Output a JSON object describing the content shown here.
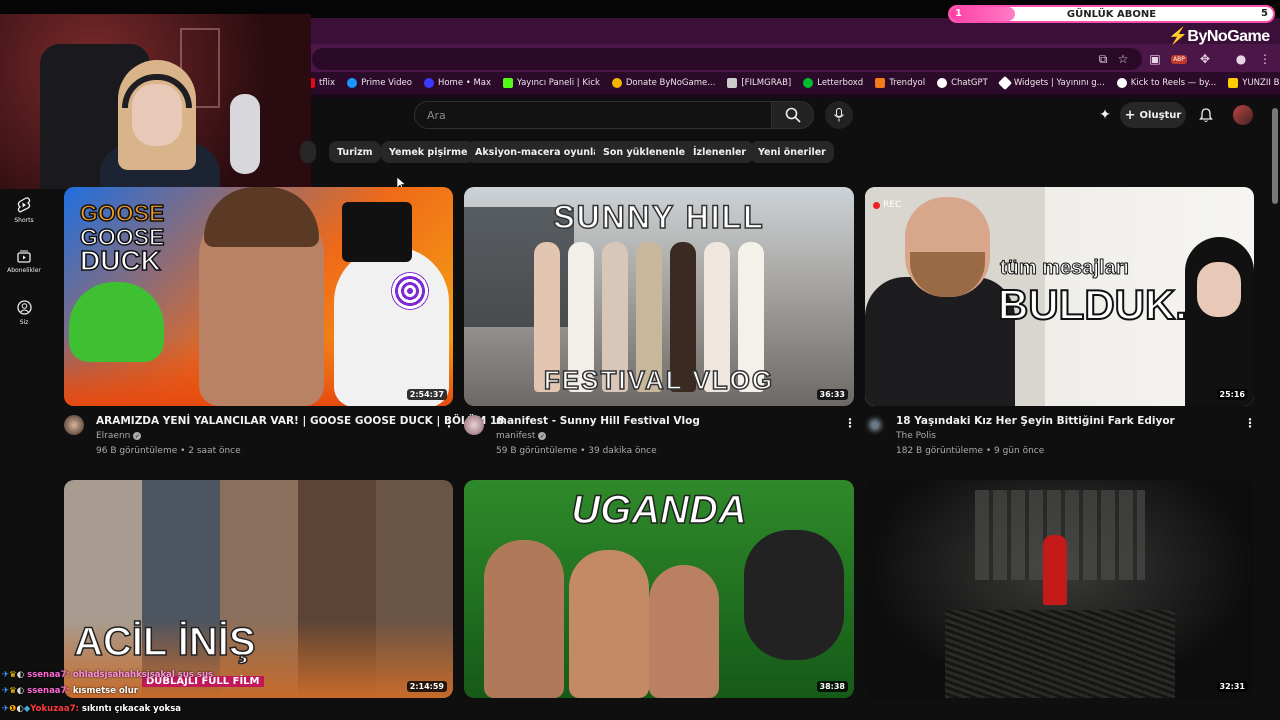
{
  "overlay": {
    "abone_label": "GÜNLÜK ABONE",
    "abone_min": "1",
    "abone_max": "5",
    "abone_progress": 0.2,
    "brand": "ByNoGame"
  },
  "bookmarks": [
    {
      "label": "tflix",
      "color": "#e50914"
    },
    {
      "label": "Prime Video",
      "color": "#1a98ff"
    },
    {
      "label": "Home • Max",
      "color": "#3b3bff"
    },
    {
      "label": "Yayıncı Paneli | Kick",
      "color": "#53fc18"
    },
    {
      "label": "Donate ByNoGame...",
      "color": "#f5b400"
    },
    {
      "label": "[FILMGRAB]",
      "color": "#cccccc"
    },
    {
      "label": "Letterboxd",
      "color": "#00c030"
    },
    {
      "label": "Trendyol",
      "color": "#f27a1a"
    },
    {
      "label": "ChatGPT",
      "color": "#ffffff"
    },
    {
      "label": "Widgets | Yayınını g...",
      "color": "#ffffff"
    },
    {
      "label": "Kick to Reels — by...",
      "color": "#ffffff"
    },
    {
      "label": "YUNZII B75 Pro Me...",
      "color": "#ffcc00"
    }
  ],
  "header": {
    "search_placeholder": "Ara",
    "create_label": "Oluştur"
  },
  "chips": [
    "Turizm",
    "Yemek pişirme",
    "Aksiyon-macera oyunları",
    "Son yüklenenler",
    "İzlenenler",
    "Yeni öneriler"
  ],
  "sidebar": [
    {
      "label": "Shorts",
      "icon": "shorts-icon"
    },
    {
      "label": "Abonelikler",
      "icon": "subscriptions-icon"
    },
    {
      "label": "Siz",
      "icon": "you-icon"
    }
  ],
  "videos": [
    {
      "title": "ARAMIZDA YENİ YALANCILAR VAR! | GOOSE GOOSE DUCK | BÖLÜM 18",
      "channel": "Elraenn",
      "verified": true,
      "meta": "96 B görüntüleme • 2 saat önce",
      "duration": "2:54:37",
      "thumb_text_1": "GOOSE",
      "thumb_text_2": "GOOSE",
      "thumb_text_3": "DUCK"
    },
    {
      "title": "manifest - Sunny Hill Festival Vlog",
      "channel": "manifest",
      "verified": true,
      "meta": "59 B görüntüleme • 39 dakika önce",
      "duration": "36:33",
      "thumb_text_1": "SUNNY HILL",
      "thumb_text_2": "FESTIVAL VLOG"
    },
    {
      "title": "18 Yaşındaki Kız Her Şeyin Bittiğini Fark Ediyor",
      "channel": "The Polis",
      "verified": false,
      "meta": "182 B görüntüleme • 9 gün önce",
      "duration": "25:16",
      "thumb_text_1": "tüm mesajları",
      "thumb_text_2": "BULDUK.",
      "thumb_text_3": "REC"
    },
    {
      "title": "",
      "channel": "",
      "verified": false,
      "meta": "",
      "duration": "2:14:59",
      "thumb_text_1": "ACİL İNİŞ",
      "thumb_text_2": "DUBLAJLI FULL FİLM"
    },
    {
      "title": "",
      "channel": "",
      "verified": false,
      "meta": "",
      "duration": "38:38",
      "thumb_text_1": "UGANDA"
    },
    {
      "title": "",
      "channel": "",
      "verified": false,
      "meta": "",
      "duration": "32:31"
    }
  ],
  "chat": [
    {
      "user": "ssenaa7:",
      "user_color": "#ff6ad5",
      "message": "ohladsjsahahksjsakal sus sus",
      "msg_color": "#ff8fe0"
    },
    {
      "user": "ssenaa7:",
      "user_color": "#ff6ad5",
      "message": "kısmetse olur",
      "msg_color": "#ffffff"
    },
    {
      "user": "Yokuzaa7:",
      "user_color": "#ff3b3b",
      "message": "sıkıntı çıkacak yoksa",
      "msg_color": "#ffffff"
    }
  ]
}
